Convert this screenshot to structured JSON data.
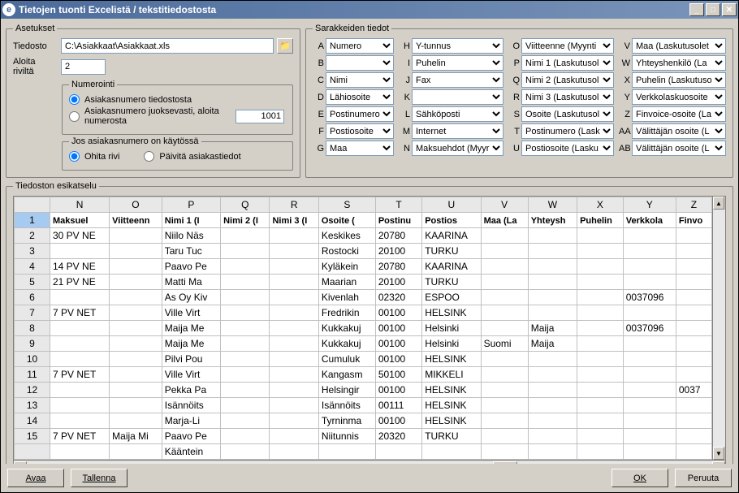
{
  "title": "Tietojen tuonti Excelistä / tekstitiedostosta",
  "settings": {
    "legend": "Asetukset",
    "file_label": "Tiedosto",
    "file_value": "C:\\Asiakkaat\\Asiakkaat.xls",
    "start_row_label": "Aloita riviltä",
    "start_row_value": "2",
    "numbering": {
      "legend": "Numerointi",
      "opt1": "Asiakasnumero tiedostosta",
      "opt2": "Asiakasnumero juoksevasti, aloita numerosta",
      "seq_value": "1001"
    },
    "existing": {
      "legend": "Jos asiakasnumero on käytössä",
      "opt1": "Ohita rivi",
      "opt2": "Päivitä asiakastiedot"
    }
  },
  "columns": {
    "legend": "Sarakkeiden tiedot",
    "items": [
      {
        "l": "A",
        "v": "Numero"
      },
      {
        "l": "H",
        "v": "Y-tunnus"
      },
      {
        "l": "O",
        "v": "Viitteenne (Myynti"
      },
      {
        "l": "V",
        "v": "Maa (Laskutusolet"
      },
      {
        "l": "B",
        "v": ""
      },
      {
        "l": "I",
        "v": "Puhelin"
      },
      {
        "l": "P",
        "v": "Nimi 1 (Laskutusol"
      },
      {
        "l": "W",
        "v": "Yhteyshenkilö (La"
      },
      {
        "l": "C",
        "v": "Nimi"
      },
      {
        "l": "J",
        "v": "Fax"
      },
      {
        "l": "Q",
        "v": "Nimi 2 (Laskutusol"
      },
      {
        "l": "X",
        "v": "Puhelin (Laskutuso"
      },
      {
        "l": "D",
        "v": "Lähiosoite"
      },
      {
        "l": "K",
        "v": ""
      },
      {
        "l": "R",
        "v": "Nimi 3 (Laskutusol"
      },
      {
        "l": "Y",
        "v": "Verkkolaskuosoite"
      },
      {
        "l": "E",
        "v": "Postinumero"
      },
      {
        "l": "L",
        "v": "Sähköposti"
      },
      {
        "l": "S",
        "v": "Osoite (Laskutusol"
      },
      {
        "l": "Z",
        "v": "Finvoice-osoite (La"
      },
      {
        "l": "F",
        "v": "Postiosoite"
      },
      {
        "l": "M",
        "v": "Internet"
      },
      {
        "l": "T",
        "v": "Postinumero (Lask"
      },
      {
        "l": "AA",
        "v": "Välittäjän osoite (L"
      },
      {
        "l": "G",
        "v": "Maa"
      },
      {
        "l": "N",
        "v": "Maksuehdot (Myyr"
      },
      {
        "l": "U",
        "v": "Postiosoite (Lasku"
      },
      {
        "l": "AB",
        "v": "Välittäjän osoite (L"
      }
    ]
  },
  "preview": {
    "legend": "Tiedoston esikatselu",
    "headers_letters": [
      "N",
      "O",
      "P",
      "Q",
      "R",
      "S",
      "T",
      "U",
      "V",
      "W",
      "X",
      "Y",
      "Z"
    ],
    "headers_names": [
      "Maksuel",
      "Viitteenn",
      "Nimi 1 (I",
      "Nimi 2 (I",
      "Nimi 3 (I",
      "Osoite (",
      "Postinu",
      "Postios",
      "Maa (La",
      "Yhteysh",
      "Puhelin",
      "Verkkola",
      "Finvo"
    ],
    "rows": [
      {
        "n": 2,
        "c": [
          "30 PV NE",
          "",
          "Niilo Näs",
          "",
          "",
          "Keskikes",
          "20780",
          "KAARINA",
          "",
          "",
          "",
          "",
          ""
        ]
      },
      {
        "n": 3,
        "c": [
          "",
          "",
          "Taru Tuc",
          "",
          "",
          "Rostocki",
          "20100",
          "TURKU",
          "",
          "",
          "",
          "",
          ""
        ]
      },
      {
        "n": 4,
        "c": [
          "14 PV NE",
          "",
          "Paavo Pe",
          "",
          "",
          "Kyläkein",
          "20780",
          "KAARINA",
          "",
          "",
          "",
          "",
          ""
        ]
      },
      {
        "n": 5,
        "c": [
          "21 PV NE",
          "",
          "Matti Ma",
          "",
          "",
          "Maarian",
          "20100",
          "TURKU",
          "",
          "",
          "",
          "",
          ""
        ]
      },
      {
        "n": 6,
        "c": [
          "",
          "",
          "As Oy Kiv",
          "",
          "",
          "Kivenlah",
          "02320",
          "ESPOO",
          "",
          "",
          "",
          "0037096",
          ""
        ]
      },
      {
        "n": 7,
        "c": [
          "7 PV NET",
          "",
          "Ville Virt",
          "",
          "",
          "Fredrikin",
          "00100",
          "HELSINK",
          "",
          "",
          "",
          "",
          ""
        ]
      },
      {
        "n": 8,
        "c": [
          "",
          "",
          "Maija Me",
          "",
          "",
          "Kukkakuj",
          "00100",
          "Helsinki",
          "",
          "Maija",
          "",
          "0037096",
          ""
        ]
      },
      {
        "n": 9,
        "c": [
          "",
          "",
          "Maija Me",
          "",
          "",
          "Kukkakuj",
          "00100",
          "Helsinki",
          "Suomi",
          "Maija",
          "",
          "",
          ""
        ]
      },
      {
        "n": 10,
        "c": [
          "",
          "",
          "Pilvi Pou",
          "",
          "",
          "Cumuluk",
          "00100",
          "HELSINK",
          "",
          "",
          "",
          "",
          ""
        ]
      },
      {
        "n": 11,
        "c": [
          "7 PV NET",
          "",
          "Ville Virt",
          "",
          "",
          "Kangasm",
          "50100",
          "MIKKELI",
          "",
          "",
          "",
          "",
          ""
        ]
      },
      {
        "n": 12,
        "c": [
          "",
          "",
          "Pekka Pa",
          "",
          "",
          "Helsingir",
          "00100",
          "HELSINK",
          "",
          "",
          "",
          "",
          "0037"
        ]
      },
      {
        "n": 13,
        "c": [
          "",
          "",
          "Isännöits",
          "",
          "",
          "Isännöits",
          "00111",
          "HELSINK",
          "",
          "",
          "",
          "",
          ""
        ]
      },
      {
        "n": 14,
        "c": [
          "",
          "",
          "Marja-Li",
          "",
          "",
          "Tyrninma",
          "00100",
          "HELSINK",
          "",
          "",
          "",
          "",
          ""
        ]
      },
      {
        "n": 15,
        "c": [
          "7 PV NET",
          "Maija Mi",
          "Paavo Pe",
          "",
          "",
          "Niitunnis",
          "20320",
          "TURKU",
          "",
          "",
          "",
          "",
          ""
        ]
      },
      {
        "n": "",
        "c": [
          "",
          "",
          "Kääntein",
          "",
          "",
          "",
          "",
          "",
          "",
          "",
          "",
          "",
          ""
        ]
      }
    ]
  },
  "footer": {
    "open": "Avaa",
    "save": "Tallenna",
    "ok": "OK",
    "cancel": "Peruuta"
  }
}
